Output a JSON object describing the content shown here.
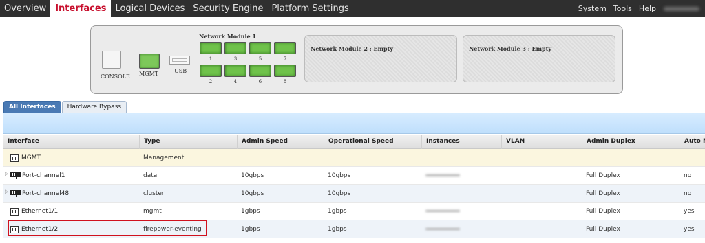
{
  "nav": {
    "items": [
      "Overview",
      "Interfaces",
      "Logical Devices",
      "Security Engine",
      "Platform Settings"
    ],
    "active": "Interfaces",
    "right": [
      "System",
      "Tools",
      "Help"
    ]
  },
  "chassis": {
    "console_label": "CONSOLE",
    "mgmt_label": "MGMT",
    "usb_label": "USB",
    "module1_title": "Network Module 1",
    "module1_ports": [
      "1",
      "3",
      "5",
      "7",
      "2",
      "4",
      "6",
      "8"
    ],
    "module2_title": "Network Module 2 : Empty",
    "module3_title": "Network Module 3 : Empty"
  },
  "tabs": [
    "All Interfaces",
    "Hardware Bypass"
  ],
  "table": {
    "columns": [
      "Interface",
      "Type",
      "Admin Speed",
      "Operational Speed",
      "Instances",
      "VLAN",
      "Admin Duplex",
      "Auto Negotiation"
    ],
    "rows": [
      {
        "interface": "MGMT",
        "type": "Management",
        "admin_speed": "",
        "oper_speed": "",
        "duplex": "",
        "auto": "",
        "icon": "interface-icon"
      },
      {
        "interface": "Port-channel1",
        "type": "data",
        "admin_speed": "10gbps",
        "oper_speed": "10gbps",
        "duplex": "Full Duplex",
        "auto": "no",
        "icon": "port-channel-icon"
      },
      {
        "interface": "Port-channel48",
        "type": "cluster",
        "admin_speed": "10gbps",
        "oper_speed": "10gbps",
        "duplex": "Full Duplex",
        "auto": "no",
        "icon": "port-channel-icon"
      },
      {
        "interface": "Ethernet1/1",
        "type": "mgmt",
        "admin_speed": "1gbps",
        "oper_speed": "1gbps",
        "duplex": "Full Duplex",
        "auto": "yes",
        "icon": "interface-icon"
      },
      {
        "interface": "Ethernet1/2",
        "type": "firepower-eventing",
        "admin_speed": "1gbps",
        "oper_speed": "1gbps",
        "duplex": "Full Duplex",
        "auto": "yes",
        "icon": "interface-icon"
      }
    ]
  },
  "colors": {
    "nav_bg": "#2f2f2f",
    "active_tab_text": "#c8102e",
    "port_green": "#6fc24a",
    "tab_blue": "#4a7ab4",
    "highlight_red": "#d0121f"
  }
}
